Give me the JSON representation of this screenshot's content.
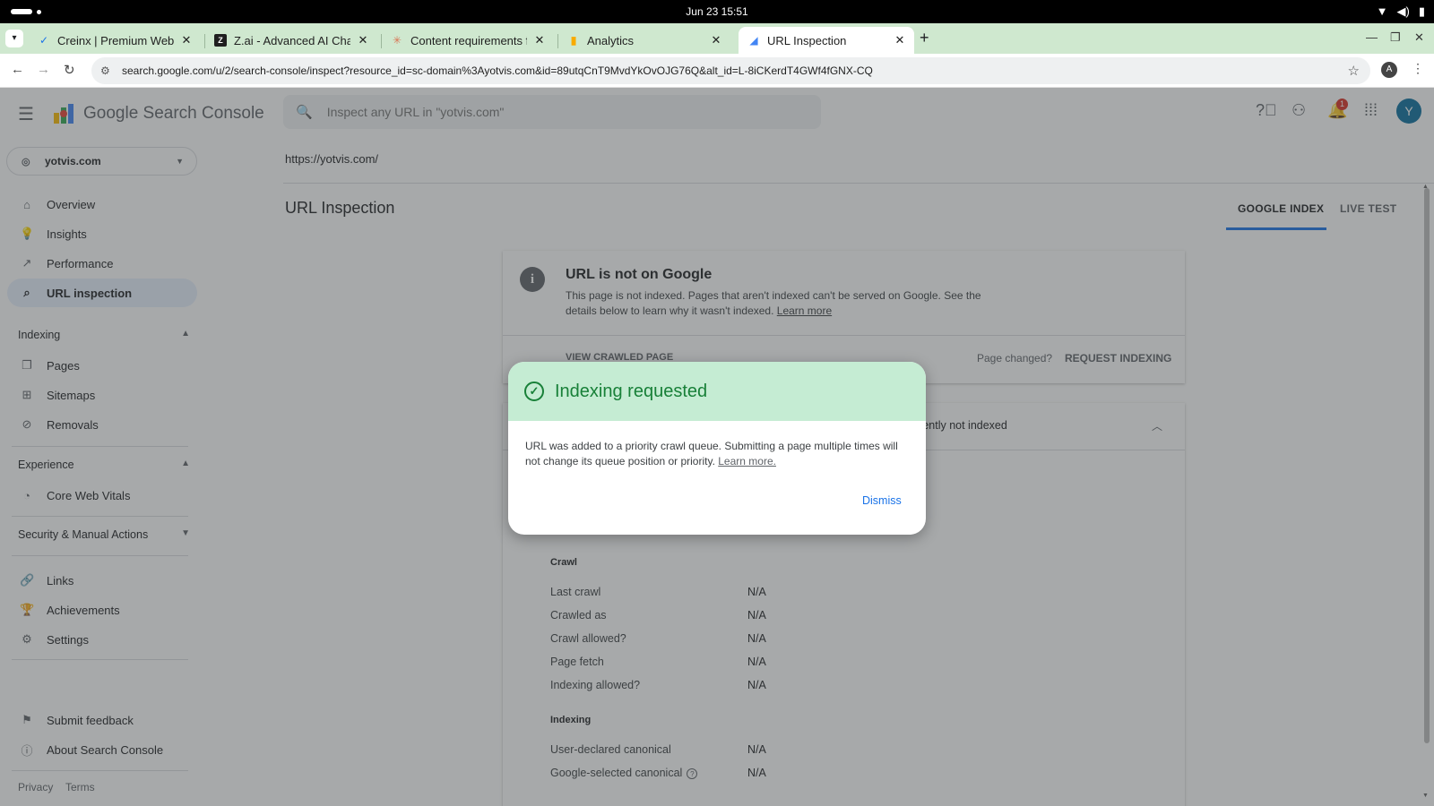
{
  "os": {
    "clock": "Jun 23  15:51"
  },
  "browser": {
    "tabs": [
      {
        "label": "Creinx | Premium Websit",
        "icon": "creinx-icon"
      },
      {
        "label": "Z.ai - Advanced AI Chatb",
        "icon": "zai-icon"
      },
      {
        "label": "Content requirements fc",
        "icon": "claude-icon"
      },
      {
        "label": "Analytics",
        "icon": "analytics-icon"
      },
      {
        "label": "URL Inspection",
        "icon": "search-console-icon"
      }
    ],
    "url": "search.google.com/u/2/search-console/inspect?resource_id=sc-domain%3Ayotvis.com&id=89utqCnT9MvdYkOvOJG76Q&alt_id=L-8iCKerdT4GWf4fGNX-CQ",
    "profile_initial": "A"
  },
  "app": {
    "title": "Google Search Console",
    "search_placeholder": "Inspect any URL in \"yotvis.com\"",
    "notification_count": "1",
    "user_initial": "Y"
  },
  "sidebar": {
    "property": "yotvis.com",
    "top_items": [
      {
        "label": "Overview"
      },
      {
        "label": "Insights"
      },
      {
        "label": "Performance"
      },
      {
        "label": "URL inspection"
      }
    ],
    "sections": {
      "indexing": "Indexing",
      "experience": "Experience",
      "security": "Security & Manual Actions"
    },
    "indexing_items": [
      {
        "label": "Pages"
      },
      {
        "label": "Sitemaps"
      },
      {
        "label": "Removals"
      }
    ],
    "experience_items": [
      {
        "label": "Core Web Vitals"
      }
    ],
    "other_items": [
      {
        "label": "Links"
      },
      {
        "label": "Achievements"
      },
      {
        "label": "Settings"
      }
    ],
    "bottom_items": [
      {
        "label": "Submit feedback"
      },
      {
        "label": "About Search Console"
      }
    ],
    "footer": {
      "privacy": "Privacy",
      "terms": "Terms"
    }
  },
  "main": {
    "inspected_url": "https://yotvis.com/",
    "heading": "URL Inspection",
    "tabs": [
      {
        "label": "GOOGLE INDEX"
      },
      {
        "label": "LIVE TEST"
      }
    ],
    "status_card": {
      "title": "URL is not on Google",
      "description": "This page is not indexed. Pages that aren't indexed can't be served on Google. See the details below to learn why it wasn't indexed.",
      "learn_more": "Learn more",
      "view_crawled": "VIEW CRAWLED PAGE",
      "page_changed": "Page changed?",
      "request_indexing": "REQUEST INDEXING"
    },
    "detail_card": {
      "status_partial": "rrently not indexed",
      "crawl_heading": "Crawl",
      "crawl_rows": [
        {
          "key": "Last crawl",
          "value": "N/A"
        },
        {
          "key": "Crawled as",
          "value": "N/A"
        },
        {
          "key": "Crawl allowed?",
          "value": "N/A"
        },
        {
          "key": "Page fetch",
          "value": "N/A"
        },
        {
          "key": "Indexing allowed?",
          "value": "N/A"
        }
      ],
      "indexing_heading": "Indexing",
      "indexing_rows": [
        {
          "key": "User-declared canonical",
          "value": "N/A"
        },
        {
          "key": "Google-selected canonical",
          "value": "N/A"
        }
      ]
    }
  },
  "dialog": {
    "title": "Indexing requested",
    "body": "URL was added to a priority crawl queue. Submitting a page multiple times will not change its queue position or priority.",
    "learn_more": "Learn more.",
    "dismiss": "Dismiss"
  },
  "colors": {
    "accent": "#1a73e8",
    "success": "#188038",
    "success_bg": "#c5ecd3",
    "tab_strip": "#cfe8cf"
  }
}
